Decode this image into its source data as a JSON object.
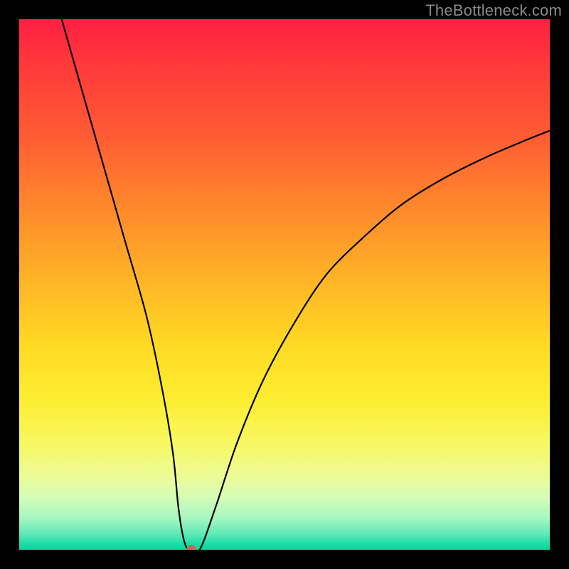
{
  "watermark": "TheBottleneck.com",
  "chart_data": {
    "type": "line",
    "title": "",
    "xlabel": "",
    "ylabel": "",
    "xlim": [
      0,
      100
    ],
    "ylim": [
      0,
      100
    ],
    "grid": false,
    "series": [
      {
        "name": "curve",
        "x": [
          8,
          12,
          16,
          20,
          24,
          27,
          29,
          30,
          31,
          32,
          34,
          37,
          41,
          46,
          52,
          58,
          65,
          72,
          80,
          88,
          95,
          100
        ],
        "y": [
          100,
          86,
          72,
          58,
          44,
          30,
          18,
          8,
          2,
          0,
          0,
          8,
          20,
          32,
          43,
          52,
          59,
          65,
          70,
          74,
          77,
          79
        ]
      }
    ],
    "marker": {
      "x": 32.5,
      "y": 0
    },
    "background_gradient": {
      "top": "#ff1f43",
      "mid": "#ffdb24",
      "bottom": "#08d49d"
    }
  }
}
